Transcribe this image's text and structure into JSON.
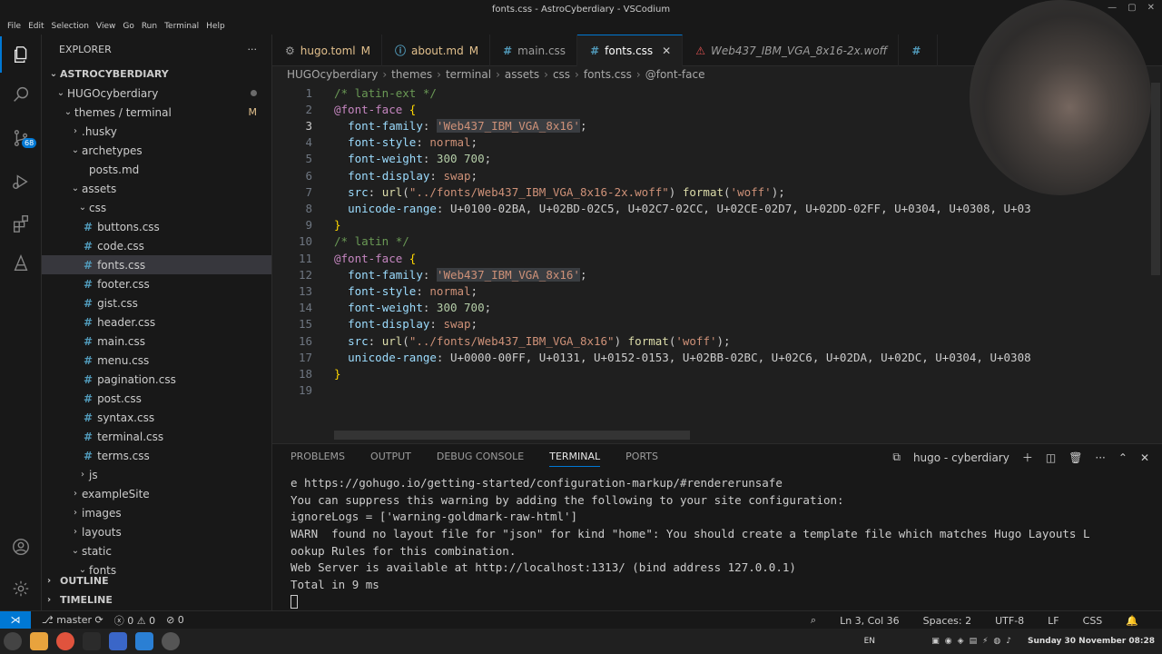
{
  "window": {
    "title": "fonts.css - AstroCyberdiary - VSCodium"
  },
  "menu": [
    "File",
    "Edit",
    "Selection",
    "View",
    "Go",
    "Run",
    "Terminal",
    "Help"
  ],
  "activity": {
    "scm_badge": "68"
  },
  "explorer": {
    "header": "EXPLORER",
    "more": "···",
    "root": "ASTROCYBERDIARY",
    "items": [
      {
        "label": "HUGOcyberdiary",
        "indent": 1,
        "chev": "⌄",
        "marker": "dot"
      },
      {
        "label": "themes / terminal",
        "indent": 2,
        "chev": "⌄",
        "marker": "M"
      },
      {
        "label": ".husky",
        "indent": 3,
        "chev": "›"
      },
      {
        "label": "archetypes",
        "indent": 3,
        "chev": "⌄"
      },
      {
        "label": "posts.md",
        "indent": 4,
        "icon": "md"
      },
      {
        "label": "assets",
        "indent": 3,
        "chev": "⌄"
      },
      {
        "label": "css",
        "indent": 4,
        "chev": "⌄"
      },
      {
        "label": "buttons.css",
        "indent": 5,
        "icon": "css"
      },
      {
        "label": "code.css",
        "indent": 5,
        "icon": "css"
      },
      {
        "label": "fonts.css",
        "indent": 5,
        "icon": "css",
        "selected": true
      },
      {
        "label": "footer.css",
        "indent": 5,
        "icon": "css"
      },
      {
        "label": "gist.css",
        "indent": 5,
        "icon": "css"
      },
      {
        "label": "header.css",
        "indent": 5,
        "icon": "css"
      },
      {
        "label": "main.css",
        "indent": 5,
        "icon": "css"
      },
      {
        "label": "menu.css",
        "indent": 5,
        "icon": "css"
      },
      {
        "label": "pagination.css",
        "indent": 5,
        "icon": "css"
      },
      {
        "label": "post.css",
        "indent": 5,
        "icon": "css"
      },
      {
        "label": "syntax.css",
        "indent": 5,
        "icon": "css"
      },
      {
        "label": "terminal.css",
        "indent": 5,
        "icon": "css"
      },
      {
        "label": "terms.css",
        "indent": 5,
        "icon": "css"
      },
      {
        "label": "js",
        "indent": 4,
        "chev": "›"
      },
      {
        "label": "exampleSite",
        "indent": 3,
        "chev": "›"
      },
      {
        "label": "images",
        "indent": 3,
        "chev": "›"
      },
      {
        "label": "layouts",
        "indent": 3,
        "chev": "›"
      },
      {
        "label": "static",
        "indent": 3,
        "chev": "⌄"
      },
      {
        "label": "fonts",
        "indent": 4,
        "chev": "⌄"
      }
    ],
    "outline": "OUTLINE",
    "timeline": "TIMELINE"
  },
  "tabs": [
    {
      "label": "hugo.toml",
      "mod": "M",
      "icon": "⚙"
    },
    {
      "label": "about.md",
      "mod": "M",
      "icon": "ⓘ"
    },
    {
      "label": "main.css",
      "icon": "#"
    },
    {
      "label": "fonts.css",
      "icon": "#",
      "active": true,
      "close": "✕"
    },
    {
      "label": "Web437_IBM_VGA_8x16-2x.woff",
      "icon": "⚠",
      "italic": true
    },
    {
      "label": "",
      "icon": "#"
    }
  ],
  "breadcrumb": [
    "HUGOcyberdiary",
    "themes",
    "terminal",
    "assets",
    "css",
    "fonts.css",
    "@font-face"
  ],
  "code_lines": [
    "/* latin-ext */",
    "@font-face {",
    "  font-family: 'Web437_IBM_VGA_8x16';",
    "  font-style: normal;",
    "  font-weight: 300 700;",
    "  font-display: swap;",
    "  src: url(\"../fonts/Web437_IBM_VGA_8x16-2x.woff\") format('woff');",
    "  unicode-range: U+0100-02BA, U+02BD-02C5, U+02C7-02CC, U+02CE-02D7, U+02DD-02FF, U+0304, U+0308, U+03",
    "}",
    "/* latin */",
    "@font-face {",
    "  font-family: 'Web437_IBM_VGA_8x16';",
    "  font-style: normal;",
    "  font-weight: 300 700;",
    "  font-display: swap;",
    "  src: url(\"../fonts/Web437_IBM_VGA_8x16\") format('woff');",
    "  unicode-range: U+0000-00FF, U+0131, U+0152-0153, U+02BB-02BC, U+02C6, U+02DA, U+02DC, U+0304, U+0308",
    "}",
    ""
  ],
  "current_line": 3,
  "panel": {
    "tabs": [
      "PROBLEMS",
      "OUTPUT",
      "DEBUG CONSOLE",
      "TERMINAL",
      "PORTS"
    ],
    "active": "TERMINAL",
    "terminal_name": "hugo - cyberdiary",
    "lines": [
      "e https://gohugo.io/getting-started/configuration-markup/#rendererunsafe",
      "You can suppress this warning by adding the following to your site configuration:",
      "ignoreLogs = ['warning-goldmark-raw-html']",
      "WARN  found no layout file for \"json\" for kind \"home\": You should create a template file which matches Hugo Layouts L",
      "ookup Rules for this combination.",
      "Web Server is available at http://localhost:1313/ (bind address 127.0.0.1)",
      "Total in 9 ms"
    ]
  },
  "status": {
    "branch": "master",
    "errors": "0",
    "warnings": "0",
    "ports": "0",
    "position": "Ln 3, Col 36",
    "spaces": "Spaces: 2",
    "encoding": "UTF-8",
    "eol": "LF",
    "language": "CSS"
  },
  "taskbar": {
    "lang": "EN",
    "clock": "Sunday 30 November 08:28"
  },
  "colors": {
    "accent": "#0078d4",
    "modified": "#e2c08d",
    "css_icon": "#519aba"
  }
}
